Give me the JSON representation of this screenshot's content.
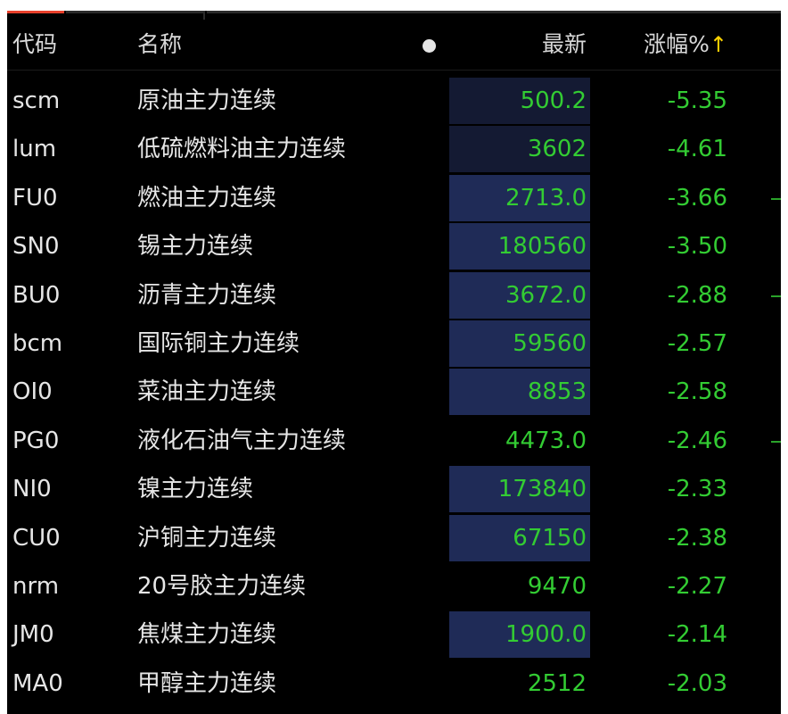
{
  "header": {
    "code": "代码",
    "name": "名称",
    "last": "最新",
    "change": "涨幅%",
    "sort_arrow": "↑"
  },
  "colors": {
    "background": "#000000",
    "up_green": "#33cc33",
    "text": "#e6e6e6",
    "highlight_dark": "#141a33",
    "highlight_blue": "#1f2b57",
    "sort_arrow": "#ffd400",
    "active_tab": "#e8412c"
  },
  "rows": [
    {
      "code": "scm",
      "name": "原油主力连续",
      "last": "500.2",
      "change": "-5.35",
      "highlight": "dark",
      "edge_mark": false
    },
    {
      "code": "lum",
      "name": "低硫燃料油主力连续",
      "last": "3602",
      "change": "-4.61",
      "highlight": "dark",
      "edge_mark": false
    },
    {
      "code": "FU0",
      "name": "燃油主力连续",
      "last": "2713.0",
      "change": "-3.66",
      "highlight": "blue",
      "edge_mark": true
    },
    {
      "code": "SN0",
      "name": "锡主力连续",
      "last": "180560",
      "change": "-3.50",
      "highlight": "blue",
      "edge_mark": false
    },
    {
      "code": "BU0",
      "name": "沥青主力连续",
      "last": "3672.0",
      "change": "-2.88",
      "highlight": "blue",
      "edge_mark": true
    },
    {
      "code": "bcm",
      "name": "国际铜主力连续",
      "last": "59560",
      "change": "-2.57",
      "highlight": "blue",
      "edge_mark": false
    },
    {
      "code": "OI0",
      "name": "菜油主力连续",
      "last": "8853",
      "change": "-2.58",
      "highlight": "blue",
      "edge_mark": false
    },
    {
      "code": "PG0",
      "name": "液化石油气主力连续",
      "last": "4473.0",
      "change": "-2.46",
      "highlight": "none",
      "edge_mark": true
    },
    {
      "code": "NI0",
      "name": "镍主力连续",
      "last": "173840",
      "change": "-2.33",
      "highlight": "blue",
      "edge_mark": false
    },
    {
      "code": "CU0",
      "name": "沪铜主力连续",
      "last": "67150",
      "change": "-2.38",
      "highlight": "blue",
      "edge_mark": false
    },
    {
      "code": "nrm",
      "name": "20号胶主力连续",
      "last": "9470",
      "change": "-2.27",
      "highlight": "none",
      "edge_mark": false
    },
    {
      "code": "JM0",
      "name": "焦煤主力连续",
      "last": "1900.0",
      "change": "-2.14",
      "highlight": "blue",
      "edge_mark": false
    },
    {
      "code": "MA0",
      "name": "甲醇主力连续",
      "last": "2512",
      "change": "-2.03",
      "highlight": "none",
      "edge_mark": false
    }
  ]
}
